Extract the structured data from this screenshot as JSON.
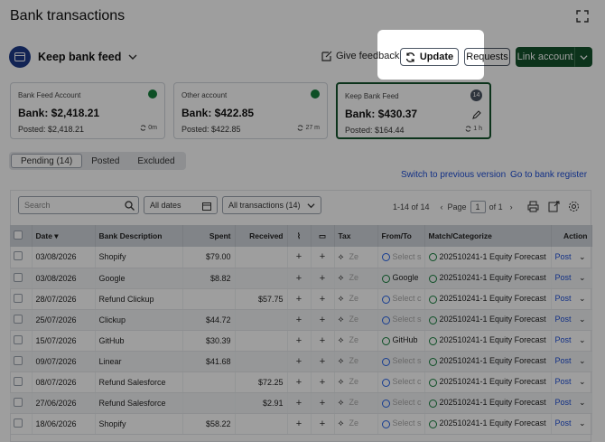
{
  "header": {
    "title": "Bank transactions"
  },
  "feed": {
    "label": "Keep bank feed"
  },
  "actions": {
    "feedback": "Give feedback",
    "update": "Update",
    "requests": "Requests",
    "link_account": "Link account"
  },
  "cards": [
    {
      "label": "Bank Feed Account",
      "bank": "Bank: $2,418.21",
      "posted": "Posted: $2,418.21",
      "sync": "0m"
    },
    {
      "label": "Other account",
      "bank": "Bank: $422.85",
      "posted": "Posted: $422.85",
      "sync": "27 m"
    },
    {
      "label": "Keep Bank Feed",
      "bank": "Bank: $430.37",
      "posted": "Posted: $164.44",
      "sync": "1 h",
      "badge": "14"
    }
  ],
  "tabs": [
    "Pending (14)",
    "Posted",
    "Excluded"
  ],
  "links": {
    "previous": "Switch to previous version",
    "register": "Go to bank register"
  },
  "filters": {
    "search_placeholder": "Search",
    "dates": "All dates",
    "transactions": "All transactions (14)"
  },
  "pager": {
    "range": "1-14 of 14",
    "page_label": "Page",
    "page": "1",
    "of": "of 1"
  },
  "table": {
    "headers": {
      "date": "Date",
      "desc": "Bank Description",
      "spent": "Spent",
      "received": "Received",
      "tax": "Tax",
      "from_to": "From/To",
      "match": "Match/Categorize",
      "action": "Action"
    },
    "rows": [
      {
        "date": "03/08/2026",
        "desc": "Shopify",
        "spent": "$79.00",
        "received": "",
        "tax": "Ze",
        "from": "Select s",
        "from_ok": false,
        "match": "202510241-1 Equity Forecast",
        "action": "Post"
      },
      {
        "date": "03/08/2026",
        "desc": "Google",
        "spent": "$8.82",
        "received": "",
        "tax": "Ze",
        "from": "Google",
        "from_ok": true,
        "match": "202510241-1 Equity Forecast",
        "action": "Post"
      },
      {
        "date": "28/07/2026",
        "desc": "Refund Clickup",
        "spent": "",
        "received": "$57.75",
        "tax": "Ze",
        "from": "Select c",
        "from_ok": false,
        "match": "202510241-1 Equity Forecast",
        "action": "Post"
      },
      {
        "date": "25/07/2026",
        "desc": "Clickup",
        "spent": "$44.72",
        "received": "",
        "tax": "Ze",
        "from": "Select s",
        "from_ok": false,
        "match": "202510241-1 Equity Forecast",
        "action": "Post"
      },
      {
        "date": "15/07/2026",
        "desc": "GitHub",
        "spent": "$30.39",
        "received": "",
        "tax": "Ze",
        "from": "GitHub",
        "from_ok": true,
        "match": "202510241-1 Equity Forecast",
        "action": "Post"
      },
      {
        "date": "09/07/2026",
        "desc": "Linear",
        "spent": "$41.68",
        "received": "",
        "tax": "Ze",
        "from": "Select s",
        "from_ok": false,
        "match": "202510241-1 Equity Forecast",
        "action": "Post"
      },
      {
        "date": "08/07/2026",
        "desc": "Refund Salesforce",
        "spent": "",
        "received": "$72.25",
        "tax": "Ze",
        "from": "Select c",
        "from_ok": false,
        "match": "202510241-1 Equity Forecast",
        "action": "Post"
      },
      {
        "date": "27/06/2026",
        "desc": "Refund Salesforce",
        "spent": "",
        "received": "$2.91",
        "tax": "Ze",
        "from": "Select c",
        "from_ok": false,
        "match": "202510241-1 Equity Forecast",
        "action": "Post"
      },
      {
        "date": "18/06/2026",
        "desc": "Shopify",
        "spent": "$58.22",
        "received": "",
        "tax": "Ze",
        "from": "Select s",
        "from_ok": false,
        "match": "202510241-1 Equity Forecast",
        "action": "Post"
      }
    ]
  }
}
